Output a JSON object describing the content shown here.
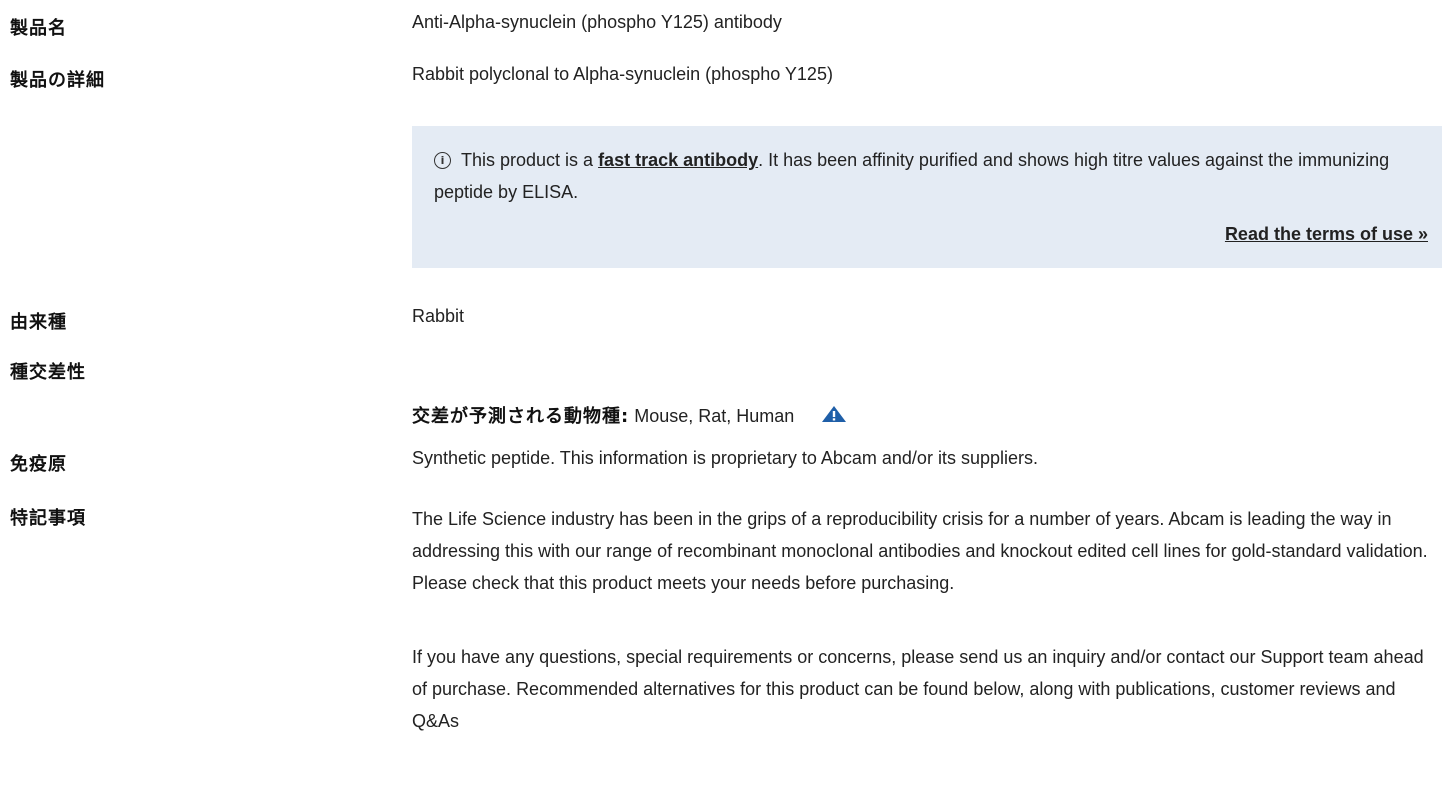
{
  "product_name": {
    "label": "製品名",
    "value": "Anti-Alpha-synuclein (phospho Y125) antibody"
  },
  "product_detail": {
    "label": "製品の詳細",
    "value": "Rabbit polyclonal to Alpha-synuclein (phospho Y125)"
  },
  "notice": {
    "icon": "info-icon",
    "prefix": "This product is a ",
    "link_text": "fast track antibody",
    "suffix": ". It has been affinity purified and shows high titre values against the immunizing peptide by ELISA.",
    "terms_link": "Read the terms of use »",
    "background": "#e4ebf4"
  },
  "host_species": {
    "label": "由来種",
    "value": "Rabbit"
  },
  "species_reactivity": {
    "label": "種交差性",
    "predicted_label": "交差が予測される動物種:",
    "predicted_value": " Mouse, Rat, Human",
    "icon": "warning-triangle-icon",
    "icon_color": "#1f5fa8"
  },
  "immunogen": {
    "label": "免疫原",
    "value": "Synthetic peptide. This information is proprietary to Abcam and/or its suppliers."
  },
  "general_notes": {
    "label": "特記事項",
    "paragraphs": [
      "The Life Science industry has been in the grips of a reproducibility crisis for a number of years. Abcam is leading the way in addressing this with our range of recombinant monoclonal antibodies and knockout edited cell lines for gold-standard validation. Please check that this product meets your needs before purchasing.",
      "If you have any questions, special requirements or concerns, please send us an inquiry and/or contact our Support team ahead of purchase. Recommended alternatives for this product can be found below, along with publications, customer reviews and Q&As"
    ]
  }
}
